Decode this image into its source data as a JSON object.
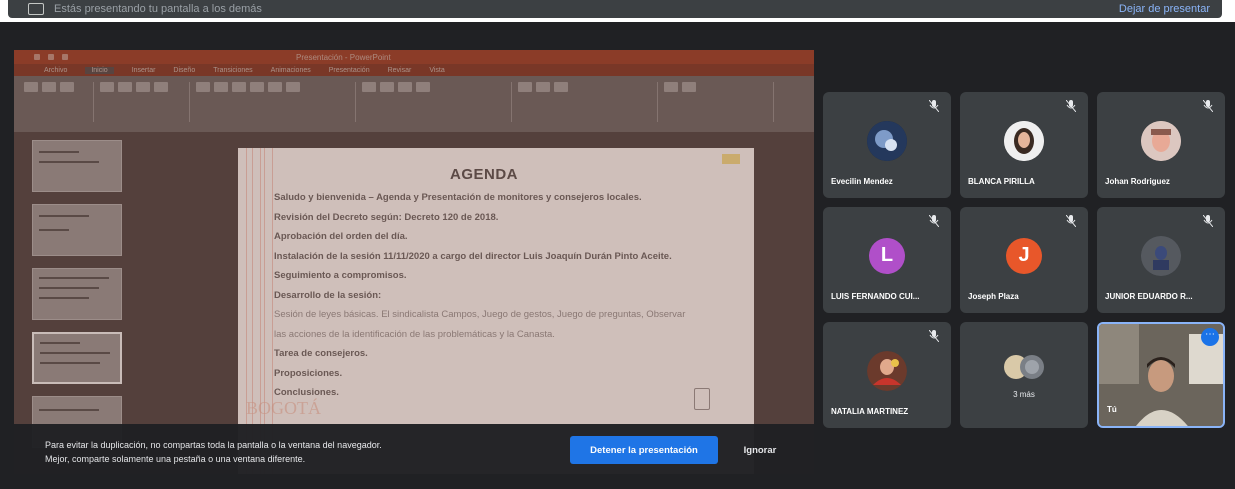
{
  "topbar": {
    "title": "Estás presentando tu pantalla a los demás",
    "right_action": "Dejar de presentar"
  },
  "powerpoint": {
    "window_title": "Presentación - PowerPoint",
    "tabs": [
      "Archivo",
      "Inicio",
      "Insertar",
      "Diseño",
      "Transiciones",
      "Animaciones",
      "Presentación",
      "Revisar",
      "Vista"
    ]
  },
  "slide": {
    "title": "AGENDA",
    "items": [
      "Saludo y bienvenida – Agenda y Presentación de monitores y consejeros locales.",
      "Revisión del Decreto según: Decreto 120 de 2018.",
      "Aprobación del orden del día.",
      "Instalación de la sesión 11/11/2020 a cargo del director Luis Joaquín Durán Pinto Aceite.",
      "Seguimiento a compromisos.",
      "Desarrollo de la sesión:",
      "Sesión de leyes básicas. El sindicalista Campos, Juego de gestos, Juego de preguntas, Observar",
      "las acciones de la identificación de las problemáticas y la Canasta.",
      "Tarea de consejeros.",
      "Proposiciones.",
      "Conclusiones."
    ],
    "stamp": "BOGOTÁ"
  },
  "warning": {
    "line1": "Para evitar la duplicación, no compartas toda la pantalla o la ventana del navegador.",
    "line2": "Mejor, comparte solamente una pestaña o una ventana diferente.",
    "stop_label": "Detener la presentación",
    "ignore_label": "Ignorar"
  },
  "participants": [
    {
      "name": "Evecilin Mendez",
      "muted": true,
      "avatar": "photo"
    },
    {
      "name": "BLANCA PIRILLA",
      "muted": true,
      "avatar": "photo"
    },
    {
      "name": "Johan Rodriguez",
      "muted": true,
      "avatar": "photo"
    },
    {
      "name": "LUIS FERNANDO CUI...",
      "muted": true,
      "avatar": "letter",
      "letter": "L",
      "color": "#b04fc9"
    },
    {
      "name": "Joseph Plaza",
      "muted": true,
      "avatar": "letter",
      "letter": "J",
      "color": "#e8572a"
    },
    {
      "name": "JUNIOR EDUARDO R...",
      "muted": true,
      "avatar": "photo"
    },
    {
      "name": "NATALIA MARTINEZ",
      "muted": true,
      "avatar": "photo"
    },
    {
      "name": "",
      "group_label": "3 más",
      "muted": false,
      "avatar": "group"
    },
    {
      "name": "Tú",
      "muted": false,
      "avatar": "video",
      "self": true
    }
  ],
  "colors": {
    "background": "#202124",
    "tile": "#3c4043",
    "primary": "#1a73e8",
    "self_border": "#8ab4f8"
  }
}
